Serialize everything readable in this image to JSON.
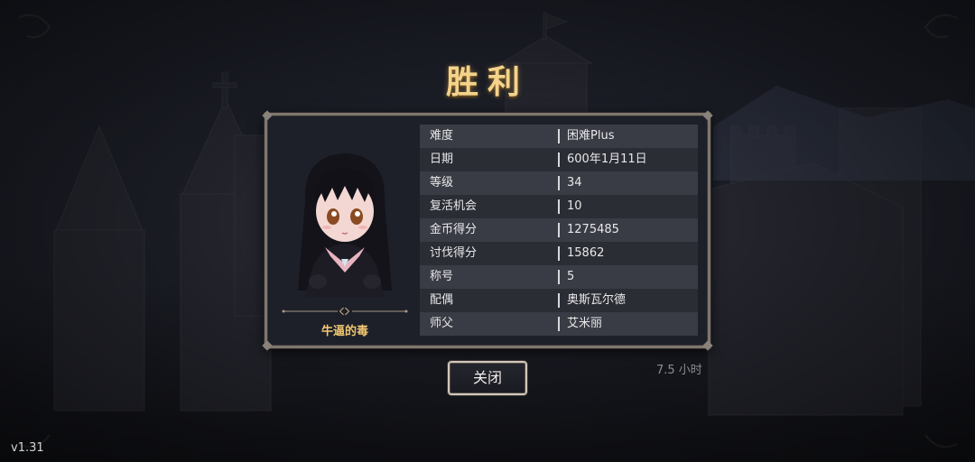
{
  "title": "胜利",
  "character": {
    "name": "牛逼的毒"
  },
  "stats": [
    {
      "label": "难度",
      "value": "困难Plus"
    },
    {
      "label": "日期",
      "value": "600年1月11日"
    },
    {
      "label": "等级",
      "value": "34"
    },
    {
      "label": "复活机会",
      "value": "10"
    },
    {
      "label": "金币得分",
      "value": "1275485"
    },
    {
      "label": "讨伐得分",
      "value": "15862"
    },
    {
      "label": "称号",
      "value": "5"
    },
    {
      "label": "配偶",
      "value": "奥斯瓦尔德"
    },
    {
      "label": "师父",
      "value": "艾米丽"
    }
  ],
  "play_time": "7.5 小时",
  "close_label": "关闭",
  "version": "v1.31",
  "colors": {
    "title": "#f4d38a",
    "name": "#f2c872",
    "panel_border": "#7f7670"
  }
}
